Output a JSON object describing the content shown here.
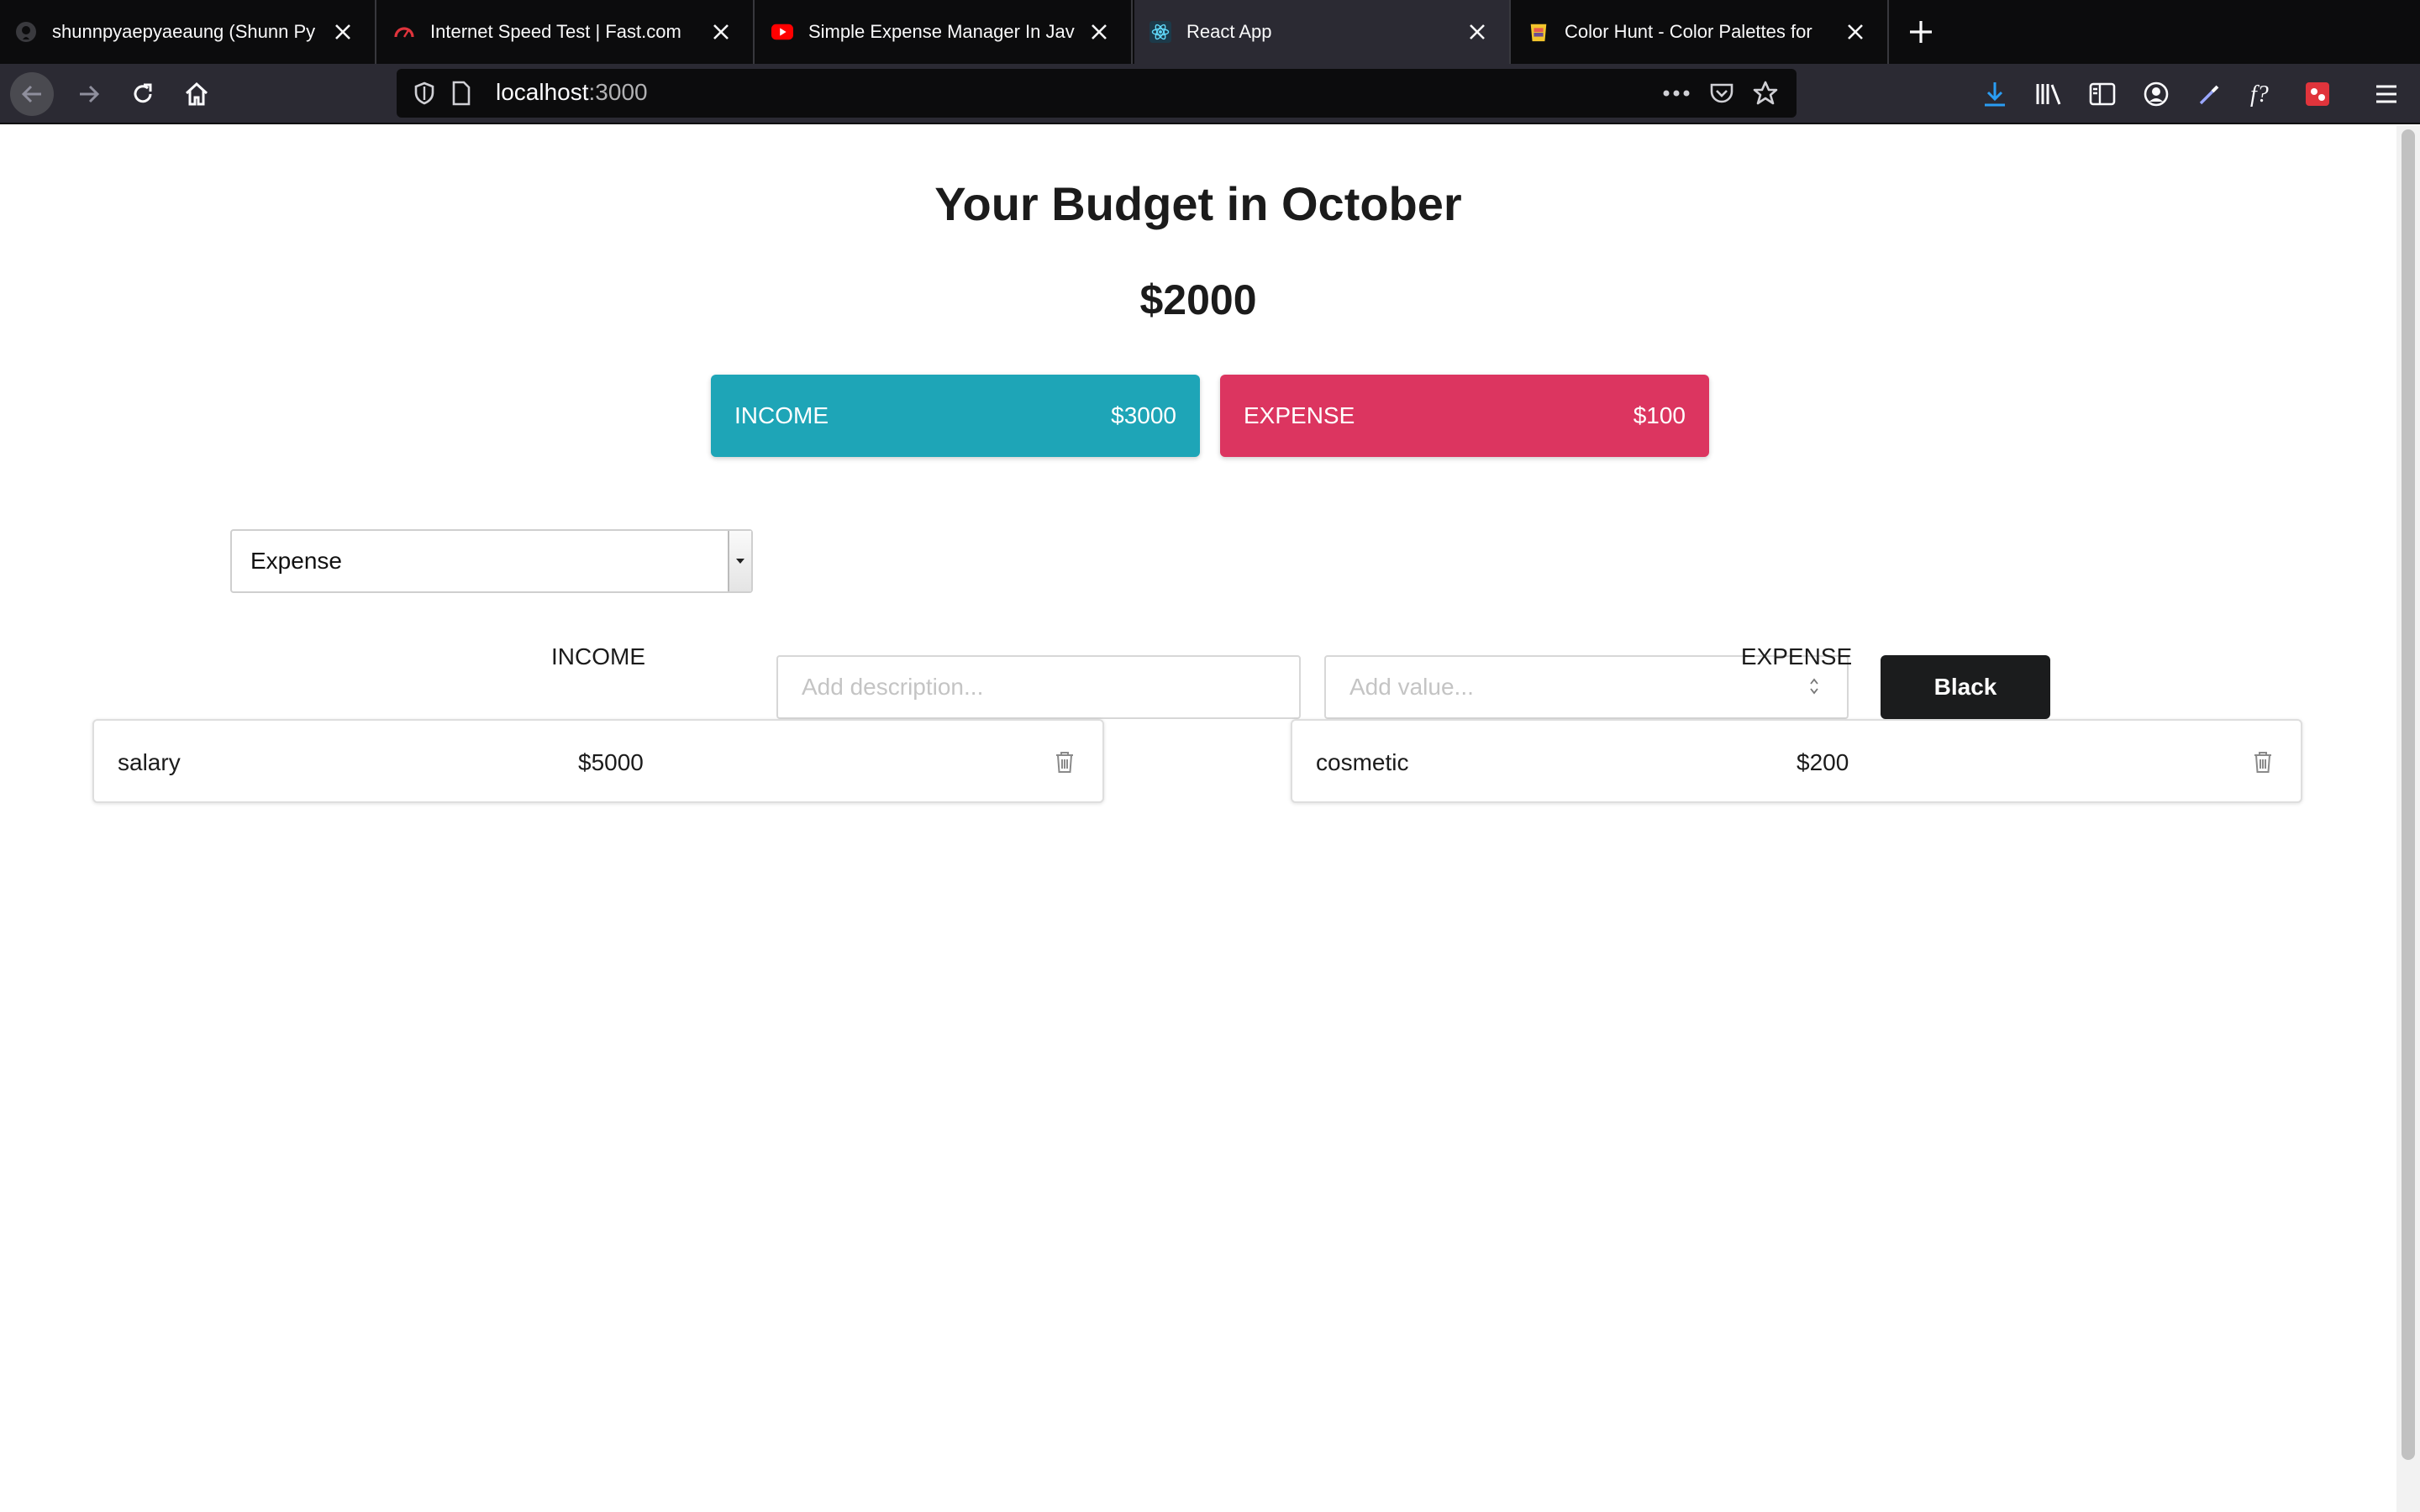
{
  "browser": {
    "tabs": [
      {
        "title": "shunnpyaepyaeaung (Shunn Py",
        "favicon": "github-icon"
      },
      {
        "title": "Internet Speed Test | Fast.com",
        "favicon": "fast-icon"
      },
      {
        "title": "Simple Expense Manager In Jav",
        "favicon": "youtube-icon"
      },
      {
        "title": "React App",
        "favicon": "react-icon",
        "active": true
      },
      {
        "title": "Color Hunt - Color Palettes for",
        "favicon": "colorhunt-icon"
      }
    ],
    "url_host": "localhost",
    "url_port": ":3000"
  },
  "page": {
    "title": "Your Budget in October",
    "total": "$2000",
    "income_summary": {
      "label": "INCOME",
      "amount": "$3000"
    },
    "expense_summary": {
      "label": "EXPENSE",
      "amount": "$100"
    },
    "colors": {
      "income": "#1ea5b7",
      "expense": "#dc3560",
      "button": "#1b1c1d"
    }
  },
  "form": {
    "type_selected": "Expense",
    "description_placeholder": "Add description...",
    "value_placeholder": "Add value...",
    "submit_label": "Black"
  },
  "lists": {
    "income_header": "INCOME",
    "expense_header": "EXPENSE",
    "income_items": [
      {
        "description": "salary",
        "value": "$5000"
      }
    ],
    "expense_items": [
      {
        "description": "cosmetic",
        "value": "$200"
      }
    ]
  }
}
